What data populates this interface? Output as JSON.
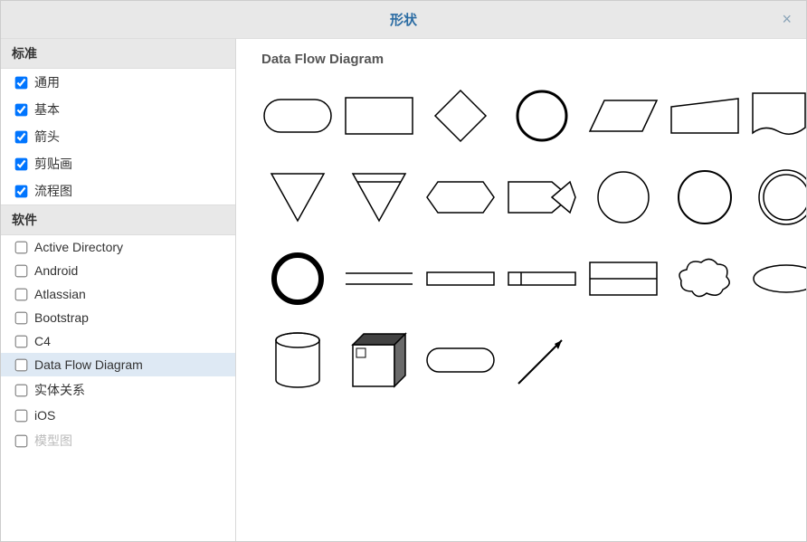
{
  "dialog": {
    "title": "形状"
  },
  "sidebar": {
    "sections": [
      {
        "label": "标准",
        "items": [
          {
            "label": "通用",
            "checked": true
          },
          {
            "label": "基本",
            "checked": true
          },
          {
            "label": "箭头",
            "checked": true
          },
          {
            "label": "剪贴画",
            "checked": true
          },
          {
            "label": "流程图",
            "checked": true
          }
        ]
      },
      {
        "label": "软件",
        "items": [
          {
            "label": "Active Directory",
            "checked": false
          },
          {
            "label": "Android",
            "checked": false
          },
          {
            "label": "Atlassian",
            "checked": false
          },
          {
            "label": "Bootstrap",
            "checked": false
          },
          {
            "label": "C4",
            "checked": false
          },
          {
            "label": "Data Flow Diagram",
            "checked": false,
            "selected": true
          },
          {
            "label": "实体关系",
            "checked": false
          },
          {
            "label": "iOS",
            "checked": false
          },
          {
            "label": "模型图",
            "checked": false,
            "faded": true
          }
        ]
      }
    ]
  },
  "content": {
    "title": "Data Flow Diagram",
    "shapes": [
      "rounded-rect",
      "rectangle",
      "diamond",
      "circle-bold",
      "parallelogram",
      "trapezoid-offset",
      "wave-bottom-rect",
      "triangle-down",
      "triangle-down-bar",
      "hexagon",
      "pentagon-arrow",
      "circle-thin",
      "circle-medium",
      "double-circle",
      "circle-thick",
      "double-line",
      "long-rect",
      "rect-divider",
      "rect-midline",
      "cloud",
      "ellipse",
      "cylinder",
      "cube-3d",
      "stadium",
      "arrow-line"
    ]
  }
}
